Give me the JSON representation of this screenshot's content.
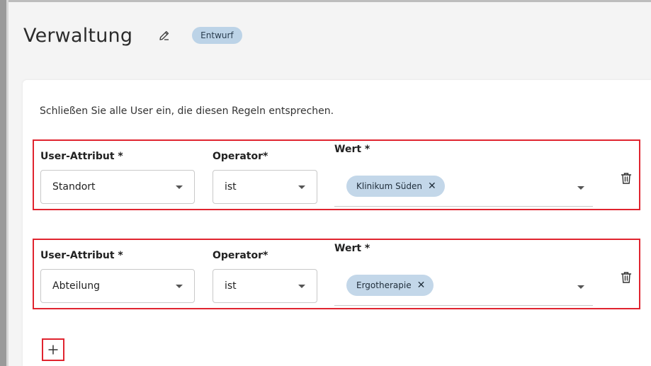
{
  "header": {
    "title": "Verwaltung",
    "status_badge": "Entwurf"
  },
  "card": {
    "intro_text": "Schließen Sie alle User ein, die diesen Regeln entsprechen."
  },
  "rules": [
    {
      "attribute_label": "User-Attribut *",
      "attribute_value": "Standort",
      "operator_label": "Operator*",
      "operator_value": "ist",
      "value_label": "Wert *",
      "value_chips": [
        "Klinikum Süden"
      ]
    },
    {
      "attribute_label": "User-Attribut *",
      "attribute_value": "Abteilung",
      "operator_label": "Operator*",
      "operator_value": "ist",
      "value_label": "Wert *",
      "value_chips": [
        "Ergotherapie"
      ]
    }
  ],
  "icons": {
    "edit": "pencil-icon",
    "chip_remove": "close-icon",
    "dropdown": "caret-down-icon",
    "delete": "trash-icon",
    "add": "plus-icon"
  },
  "colors": {
    "highlight_border": "#e0242f",
    "chip_background": "#c3d7e9",
    "badge_background": "#bcd3e7"
  }
}
